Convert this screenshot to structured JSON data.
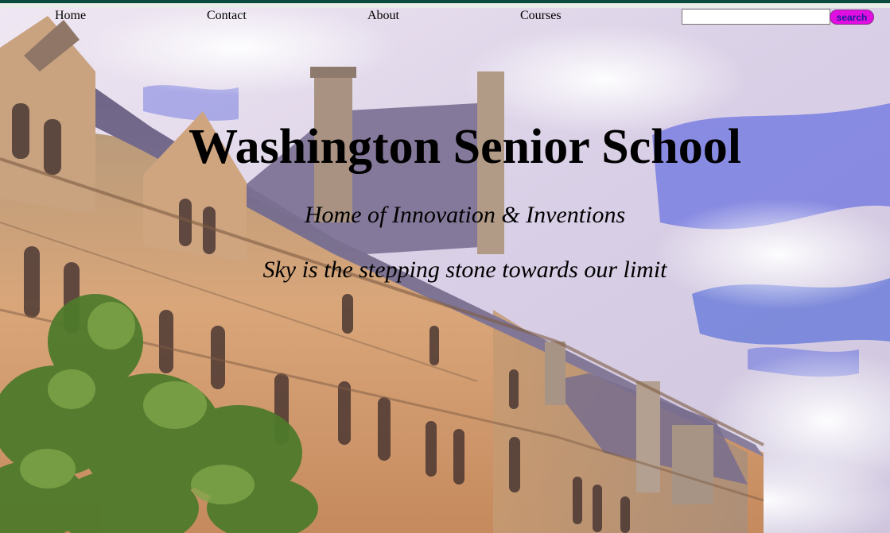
{
  "nav": {
    "links": [
      {
        "label": "Home"
      },
      {
        "label": "Contact"
      },
      {
        "label": "About"
      },
      {
        "label": "Courses"
      }
    ],
    "search": {
      "value": "",
      "button_label": "search"
    }
  },
  "hero": {
    "title": "Washington Senior School",
    "subtitle": "Home of Innovation & Inventions",
    "tagline": "Sky is the stepping stone towards our limit"
  },
  "colors": {
    "top_band": "#0b4a3c",
    "search_button": "#e10ee1",
    "search_button_text": "#1b1b9a"
  }
}
